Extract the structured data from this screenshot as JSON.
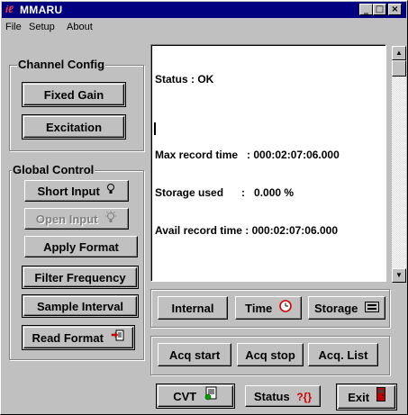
{
  "window": {
    "title": "MMARU",
    "minimize": "_",
    "maximize": "□",
    "close": "×"
  },
  "menu": [
    "File",
    "Setup",
    "About"
  ],
  "channel_config": {
    "label": "Channel Config",
    "fixed_gain": "Fixed Gain",
    "excitation": "Excitation"
  },
  "global_control": {
    "label": "Global Control",
    "short_input": "Short Input",
    "open_input": "Open Input",
    "apply_format": "Apply Format",
    "filter_frequency": "Filter Frequency",
    "sample_interval": "Sample Interval",
    "read_format": "Read Format"
  },
  "status_panel": {
    "status": "Status : OK",
    "max_record_time": "Max record time   : 000:02:07:06.000",
    "storage_used": "Storage used      :   0.000 %",
    "avail_record_time": "Avail record time : 000:02:07:06.000"
  },
  "mode_buttons": {
    "internal": "Internal",
    "time": "Time",
    "storage": "Storage"
  },
  "acq_buttons": {
    "start": "Acq start",
    "stop": "Acq stop",
    "list": "Acq. List"
  },
  "bottom_buttons": {
    "cvt": "CVT",
    "status": "Status",
    "exit": "Exit"
  },
  "icons": {
    "app": "ilc-logo-icon",
    "short_input": "bulb-icon",
    "open_input": "bulb-lit-icon",
    "read_format": "document-arrow-icon",
    "time": "clock-icon",
    "storage": "storage-device-icon",
    "cvt": "convert-document-icon",
    "status": "status-query-icon",
    "exit": "exit-door-icon"
  },
  "colors": {
    "titlebar": "#000080",
    "face": "#c0c0c0",
    "status_bg": "#ffffff",
    "clock_icon": "#d00000",
    "exit_icon": "#c00000"
  }
}
